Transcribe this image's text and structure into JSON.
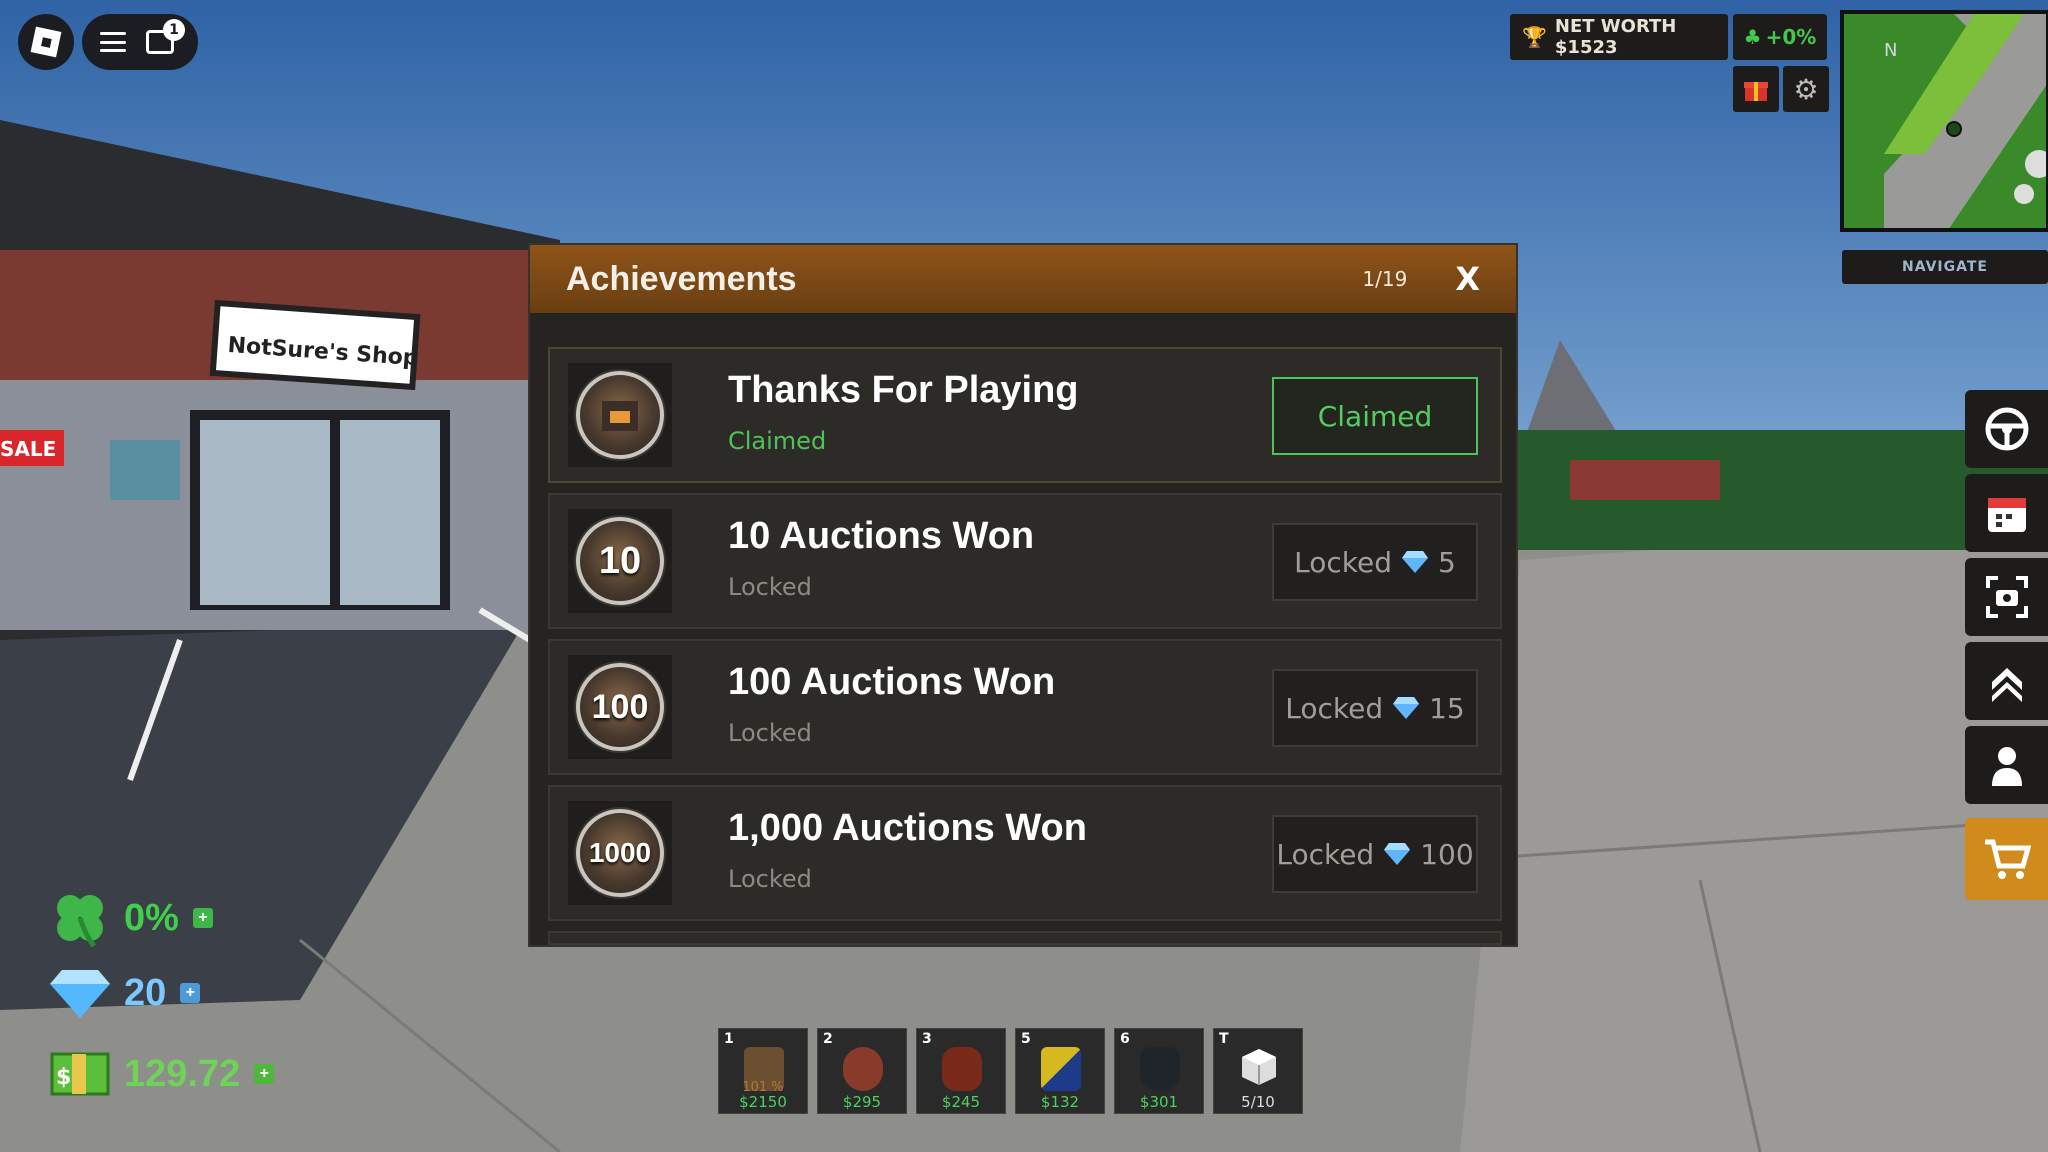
{
  "top_left": {
    "chat_badge": "1"
  },
  "top_right": {
    "net_worth": "NET WORTH $1523",
    "luck_boost": "+0%",
    "minimap_north": "N",
    "navigate_label": "NAVIGATE"
  },
  "scene": {
    "shop_sign": "NotSure's Shop",
    "sale_sign": "SALE"
  },
  "modal": {
    "title": "Achievements",
    "count": "1/19",
    "close": "X",
    "rows": [
      {
        "badge": "",
        "title": "Thanks For Playing",
        "status": "Claimed",
        "button": "Claimed",
        "reward": ""
      },
      {
        "badge": "10",
        "title": "10 Auctions Won",
        "status": "Locked",
        "button": "Locked",
        "reward": "5"
      },
      {
        "badge": "100",
        "title": "100 Auctions Won",
        "status": "Locked",
        "button": "Locked",
        "reward": "15"
      },
      {
        "badge": "1000",
        "title": "1,000 Auctions Won",
        "status": "Locked",
        "button": "Locked",
        "reward": "100"
      }
    ]
  },
  "stats": {
    "luck": "0%",
    "gems": "20",
    "cash": "129.72"
  },
  "hotbar": [
    {
      "key": "1",
      "sub": "101 %",
      "price": "$2150",
      "color": "#6a5030"
    },
    {
      "key": "2",
      "sub": "",
      "price": "$295",
      "color": "#8a3a2a"
    },
    {
      "key": "3",
      "sub": "",
      "price": "$245",
      "color": "#7a2a1a"
    },
    {
      "key": "5",
      "sub": "",
      "price": "$132",
      "color": "#b8a020"
    },
    {
      "key": "6",
      "sub": "",
      "price": "$301",
      "color": "#20252a"
    },
    {
      "key": "T",
      "sub": "",
      "price": "5/10",
      "color": ""
    }
  ],
  "colors": {
    "accent": "#8e5418",
    "green": "#4fc25a",
    "cart": "#d08b1c"
  }
}
